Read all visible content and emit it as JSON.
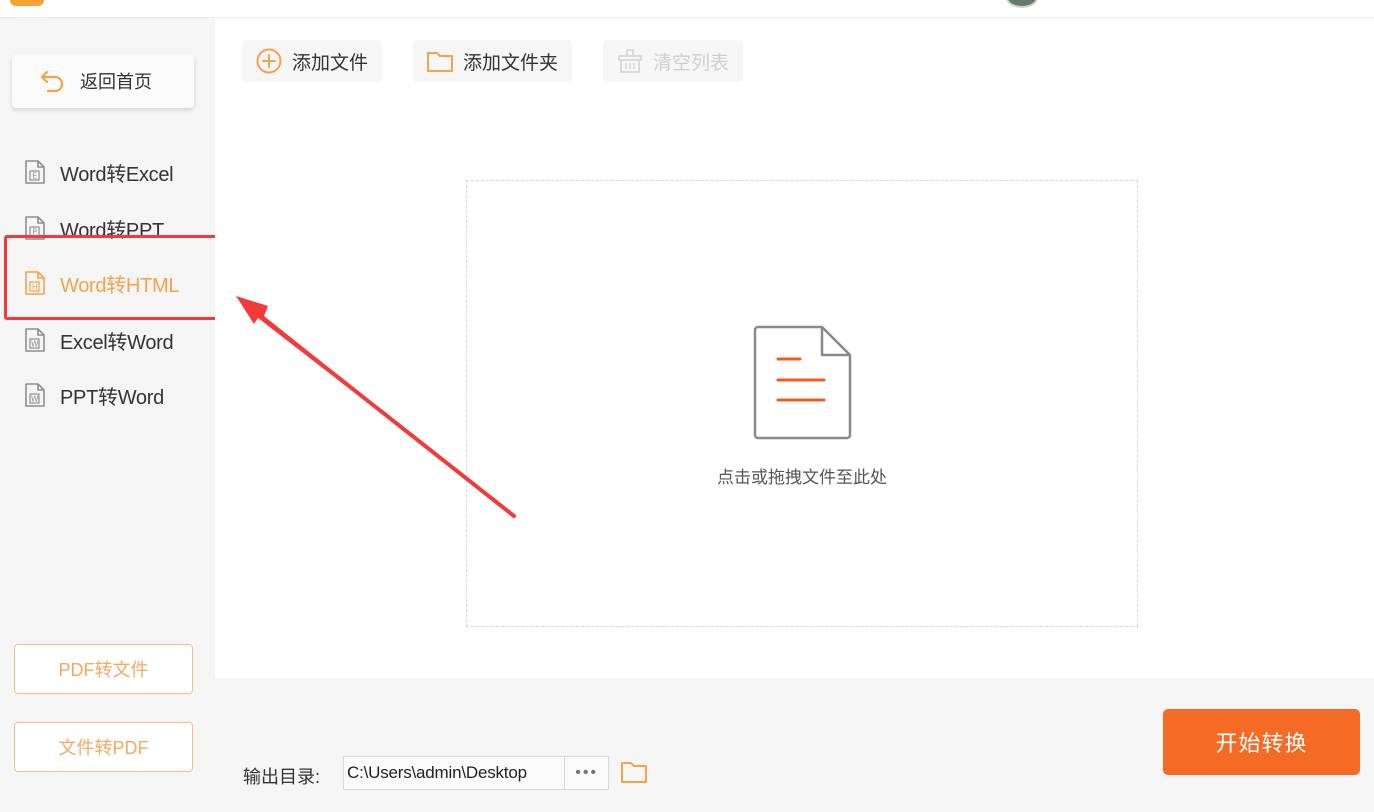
{
  "sidebar": {
    "home_label": "返回首页",
    "items": [
      {
        "label": "Word转Excel",
        "letter": "E",
        "active": false
      },
      {
        "label": "Word转PPT",
        "letter": "P",
        "active": false
      },
      {
        "label": "Word转HTML",
        "letter": "H",
        "active": true
      },
      {
        "label": "Excel转Word",
        "letter": "W",
        "active": false
      },
      {
        "label": "PPT转Word",
        "letter": "W",
        "active": false
      }
    ],
    "pdf_to_file": "PDF转文件",
    "file_to_pdf": "文件转PDF"
  },
  "toolbar": {
    "add_file": "添加文件",
    "add_folder": "添加文件夹",
    "clear_list": "清空列表"
  },
  "dropzone": {
    "hint": "点击或拖拽文件至此处"
  },
  "output": {
    "label": "输出目录:",
    "path": "C:\\Users\\admin\\Desktop",
    "more": "•••"
  },
  "start_button": "开始转换",
  "colors": {
    "accent": "#f56a24",
    "active_text": "#f5a24a",
    "highlight": "#f23a3a"
  }
}
